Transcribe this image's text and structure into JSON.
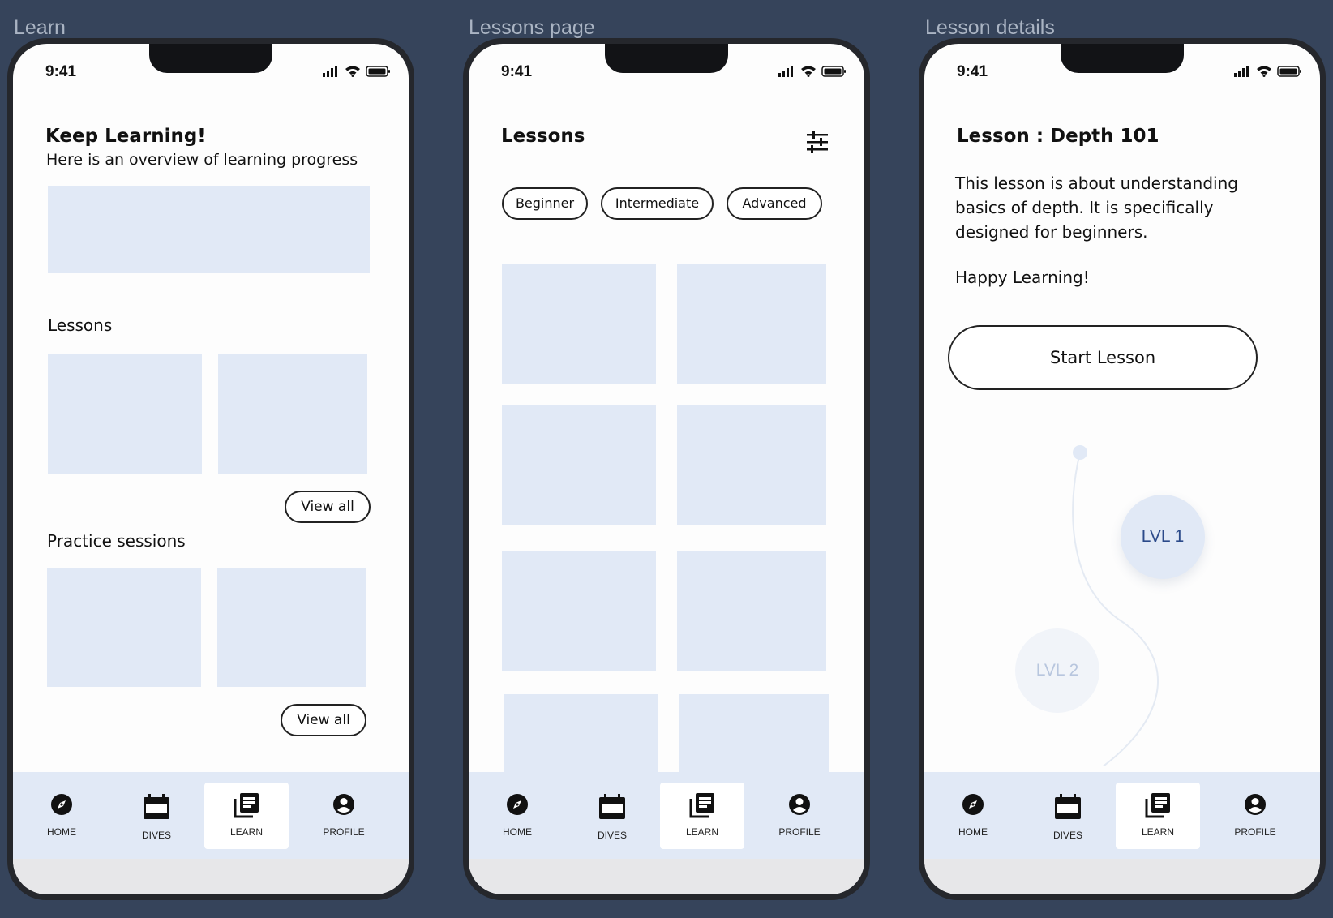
{
  "frames": [
    {
      "label": "Learn"
    },
    {
      "label": "Lessons page"
    },
    {
      "label": "Lesson details"
    }
  ],
  "status_bar": {
    "time": "9:41"
  },
  "learn": {
    "title": "Keep Learning!",
    "subtitle": "Here is an overview of learning progress",
    "lessons_heading": "Lessons",
    "view_all": "View all",
    "practice_heading": "Practice sessions"
  },
  "lessons_page": {
    "title": "Lessons",
    "filters": [
      "Beginner",
      "Intermediate",
      "Advanced"
    ],
    "filter_icon": "sliders-icon"
  },
  "lesson_details": {
    "title": "Lesson : Depth 101",
    "description": [
      "This lesson is about understanding",
      "basics of depth. It is specifically",
      "designed for beginners."
    ],
    "greeting": "Happy Learning!",
    "start_button": "Start Lesson",
    "levels": [
      "LVL 1",
      "LVL 2"
    ]
  },
  "tabbar": {
    "items": [
      {
        "label": "HOME",
        "icon": "compass-icon"
      },
      {
        "label": "DIVES",
        "icon": "calendar-icon"
      },
      {
        "label": "LEARN",
        "icon": "library-icon",
        "active": true
      },
      {
        "label": "PROFILE",
        "icon": "user-circle-icon"
      }
    ]
  },
  "colors": {
    "background": "#36445b",
    "placeholder": "#e1e9f6",
    "level_active_text": "#2b4a8a",
    "level_inactive_text": "#b8c6de"
  }
}
